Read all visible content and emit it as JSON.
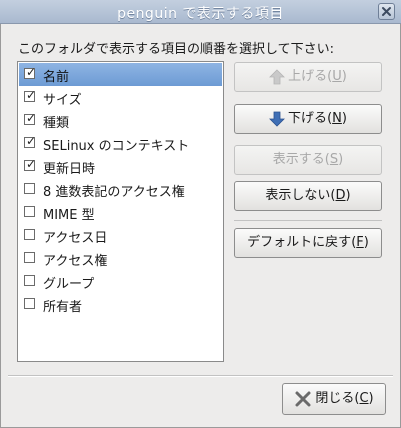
{
  "window": {
    "title": "penguin で表示する項目"
  },
  "instruction": "このフォルダで表示する項目の順番を選択して下さい:",
  "columns": [
    {
      "label": "名前",
      "checked": true,
      "selected": true
    },
    {
      "label": "サイズ",
      "checked": true,
      "selected": false
    },
    {
      "label": "種類",
      "checked": true,
      "selected": false
    },
    {
      "label": "SELinux のコンテキスト",
      "checked": true,
      "selected": false
    },
    {
      "label": "更新日時",
      "checked": true,
      "selected": false
    },
    {
      "label": "8 進数表記のアクセス権",
      "checked": false,
      "selected": false
    },
    {
      "label": "MIME 型",
      "checked": false,
      "selected": false
    },
    {
      "label": "アクセス日",
      "checked": false,
      "selected": false
    },
    {
      "label": "アクセス権",
      "checked": false,
      "selected": false
    },
    {
      "label": "グループ",
      "checked": false,
      "selected": false
    },
    {
      "label": "所有者",
      "checked": false,
      "selected": false
    }
  ],
  "buttons": {
    "move_up": {
      "label": "上げる",
      "mnemonic": "U",
      "enabled": false
    },
    "move_down": {
      "label": "下げる",
      "mnemonic": "N",
      "enabled": true
    },
    "show": {
      "label": "表示する",
      "mnemonic": "S",
      "enabled": false
    },
    "hide": {
      "label": "表示しない",
      "mnemonic": "D",
      "enabled": true
    },
    "reset": {
      "label": "デフォルトに戻す",
      "mnemonic": "F",
      "enabled": true
    },
    "close": {
      "label": "閉じる",
      "mnemonic": "C",
      "enabled": true
    }
  },
  "icons": {
    "window_close": "close-icon",
    "move_up": "arrow-up-icon",
    "move_down": "arrow-down-icon",
    "close": "close-icon"
  },
  "colors": {
    "selection": "#7aa4d8",
    "arrow_down": "#3f6fb5",
    "disabled_text": "#a8a8a8"
  }
}
